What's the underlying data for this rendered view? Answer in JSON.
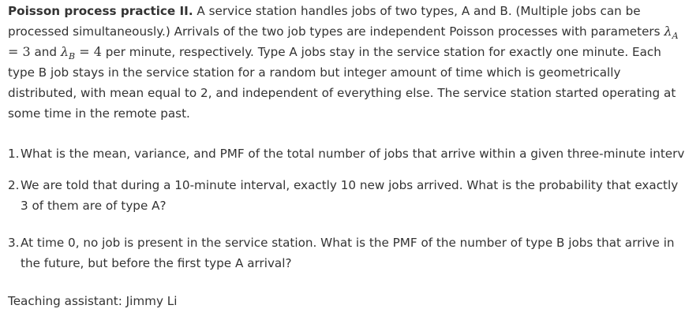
{
  "problem": {
    "title": "Poisson process practice II.",
    "intro_part1": " A service station handles jobs of two types, A and B. (Multiple jobs can be processed simultaneously.) Arrivals of the two job types are independent Poisson processes with parameters ",
    "lambda_A_symbol": "λ",
    "lambda_A_subscript": "A",
    "lambda_A_value": " = 3",
    "intro_and": " and",
    "lambda_B_symbol": "λ",
    "lambda_B_subscript": "B",
    "lambda_B_value": " = 4",
    "intro_part2": " per minute, respectively. Type A jobs stay in the service station for exactly one minute. Each type B job stays in the service station for a random but integer amount of time which is geometrically distributed, with mean equal to 2, and independent of everything else. The service station started operating at some time in the remote past."
  },
  "questions": [
    {
      "number": "1.",
      "text": "What is the mean, variance, and PMF of the total number of jobs that arrive within a given three-minute interval?"
    },
    {
      "number": "2.",
      "text": "We are told that during a 10-minute interval, exactly 10 new jobs arrived. What is the probability that exactly 3 of them are of type A?"
    },
    {
      "number": "3.",
      "text": "At time 0, no job is present in the service station. What is the PMF of the number of type B jobs that arrive in the future, but before the first type A arrival?"
    }
  ],
  "footer": {
    "teaching_assistant": "Teaching assistant: Jimmy Li"
  }
}
